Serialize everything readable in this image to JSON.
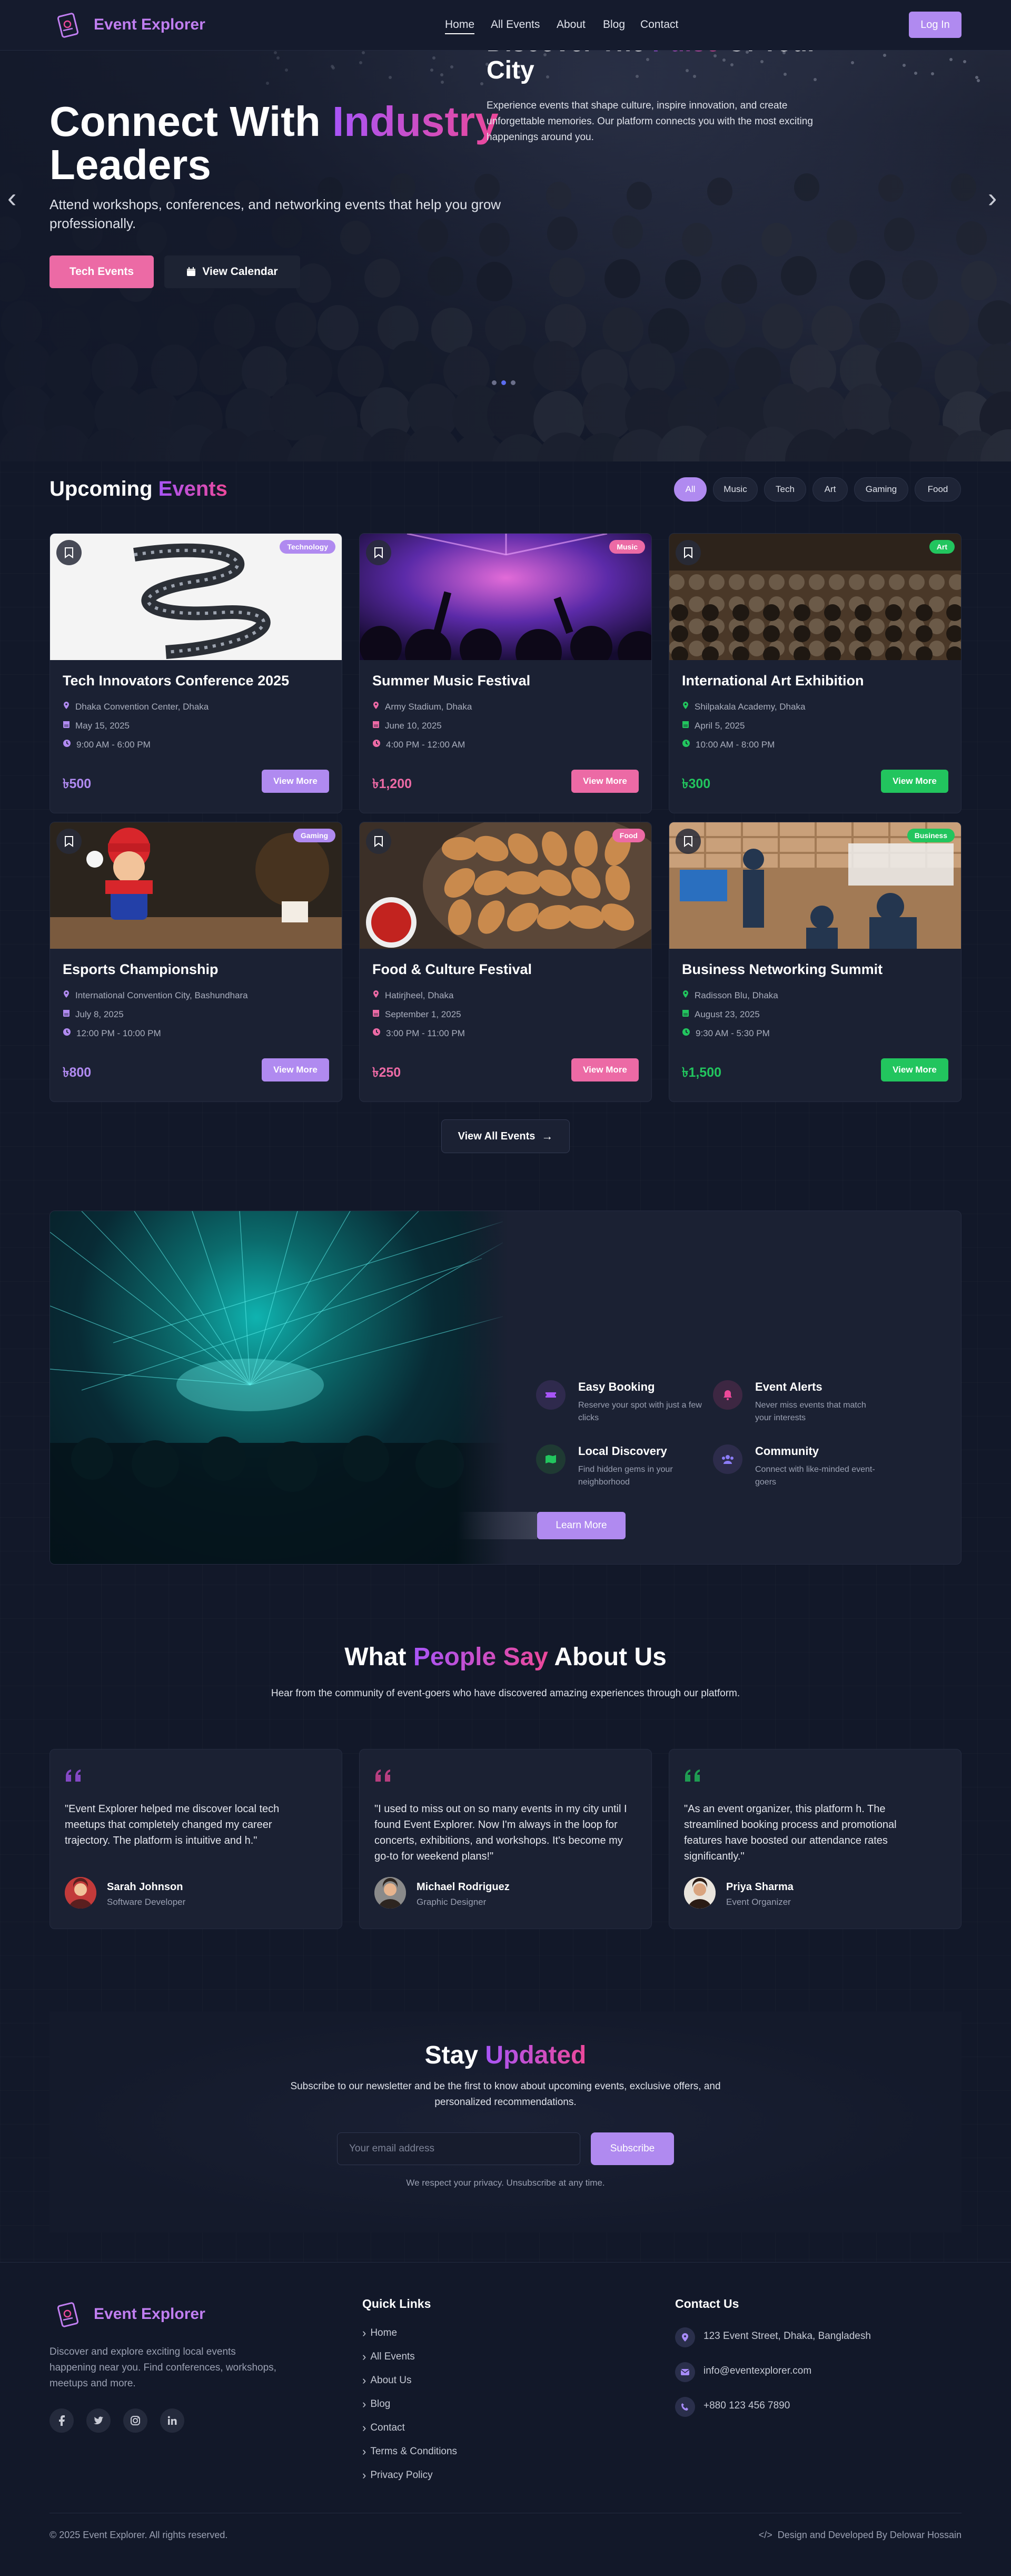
{
  "nav": {
    "brand": "Event Explorer",
    "links": [
      "Home",
      "All Events",
      "About",
      "Blog",
      "Contact"
    ],
    "login": "Log In"
  },
  "hero": {
    "title_part1": "Connect With ",
    "title_highlight": "Industry",
    "title_part2": "Leaders",
    "subtitle": "Attend workshops, conferences, and networking events that help you grow professionally.",
    "primary_button": "Tech Events",
    "secondary_button": "View Calendar",
    "slides_total": 3,
    "active_slide": 2
  },
  "events": {
    "title_part1": "Upcoming ",
    "title_highlight": "Events",
    "filters": [
      "All",
      "Music",
      "Tech",
      "Art",
      "Gaming",
      "Food"
    ],
    "active_filter": "All",
    "cards": [
      {
        "title": "Tech Innovators Conference 2025",
        "badge": "Technology",
        "location": "Dhaka Convention Center, Dhaka",
        "date": "May 15, 2025",
        "time": "9:00 AM - 6:00 PM",
        "price": "৳500",
        "button": "View More",
        "accent": "#b08af0"
      },
      {
        "title": "Summer Music Festival",
        "badge": "Music",
        "location": "Army Stadium, Dhaka",
        "date": "June 10, 2025",
        "time": "4:00 PM - 12:00 AM",
        "price": "৳1,200",
        "button": "View More",
        "accent": "#ec6aa5"
      },
      {
        "title": "International Art Exhibition",
        "badge": "Art",
        "location": "Shilpakala Academy, Dhaka",
        "date": "April 5, 2025",
        "time": "10:00 AM - 8:00 PM",
        "price": "৳300",
        "button": "View More",
        "accent": "#22c55e"
      },
      {
        "title": "Esports Championship",
        "badge": "Gaming",
        "location": "International Convention City, Bashundhara",
        "date": "July 8, 2025",
        "time": "12:00 PM - 10:00 PM",
        "price": "৳800",
        "button": "View More",
        "accent": "#b08af0"
      },
      {
        "title": "Food & Culture Festival",
        "badge": "Food",
        "location": "Hatirjheel, Dhaka",
        "date": "September 1, 2025",
        "time": "3:00 PM - 11:00 PM",
        "price": "৳250",
        "button": "View More",
        "accent": "#ec6aa5"
      },
      {
        "title": "Business Networking Summit",
        "badge": "Business",
        "location": "Radisson Blu, Dhaka",
        "date": "August 23, 2025",
        "time": "9:30 AM - 5:30 PM",
        "price": "৳1,500",
        "button": "View More",
        "accent": "#22c55e"
      }
    ],
    "view_all": "View All Events"
  },
  "discover": {
    "title_part1": "Discover The ",
    "title_highlight": "Pulse",
    "title_part2": " Of Your City",
    "text": "Experience events that shape culture, inspire innovation, and create unforgettable memories. Our platform connects you with the most exciting happenings around you.",
    "features": [
      {
        "title": "Easy Booking",
        "desc": "Reserve your spot with just a few clicks",
        "icon": "ticket-icon",
        "color": "#a855f7"
      },
      {
        "title": "Event Alerts",
        "desc": "Never miss events that match your interests",
        "icon": "bell-icon",
        "color": "#ec4899"
      },
      {
        "title": "Local Discovery",
        "desc": "Find hidden gems in your neighborhood",
        "icon": "map-icon",
        "color": "#22c55e"
      },
      {
        "title": "Community",
        "desc": "Connect with like-minded event-goers",
        "icon": "users-icon",
        "color": "#8b7cf6"
      }
    ],
    "button": "Learn More"
  },
  "testimonials": {
    "title_part1": "What ",
    "title_highlight": "People Say",
    "title_part2": " About Us",
    "subtitle": "Hear from the community of event-goers who have discovered amazing experiences through our platform.",
    "items": [
      {
        "quote": "\"Event Explorer helped me discover local tech meetups that completely changed my career trajectory. The platform is intuitive and h.\"",
        "name": "Sarah Johnson",
        "role": "Software Developer",
        "color": "#a855f7"
      },
      {
        "quote": "\"I used to miss out on so many events in my city until I found Event Explorer. Now I'm always in the loop for concerts, exhibitions, and workshops. It's become my go-to for weekend plans!\"",
        "name": "Michael Rodriguez",
        "role": "Graphic Designer",
        "color": "#ec4899"
      },
      {
        "quote": "\"As an event organizer, this platform h. The streamlined booking process and promotional features have boosted our attendance rates significantly.\"",
        "name": "Priya Sharma",
        "role": "Event Organizer",
        "color": "#22c55e"
      }
    ]
  },
  "newsletter": {
    "title_part1": "Stay ",
    "title_highlight": "Updated",
    "subtitle": "Subscribe to our newsletter and be the first to know about upcoming events, exclusive offers, and personalized recommendations.",
    "placeholder": "Your email address",
    "button": "Subscribe",
    "note": "We respect your privacy. Unsubscribe at any time."
  },
  "footer": {
    "brand": "Event Explorer",
    "desc": "Discover and explore exciting local events happening near you. Find conferences, workshops, meetups and more.",
    "social": [
      "f",
      "t",
      "ig",
      "in"
    ],
    "quick_links_title": "Quick Links",
    "quick_links": [
      "Home",
      "All Events",
      "About Us",
      "Blog",
      "Contact",
      "Terms & Conditions",
      "Privacy Policy"
    ],
    "contact_title": "Contact Us",
    "address": "123 Event Street, Dhaka, Bangladesh",
    "email": "info@eventexplorer.com",
    "phone": "+880 123 456 7890",
    "copyright": "© 2025 Event Explorer. All rights reserved.",
    "credit": "Design and Developed By Delowar Hossain"
  }
}
